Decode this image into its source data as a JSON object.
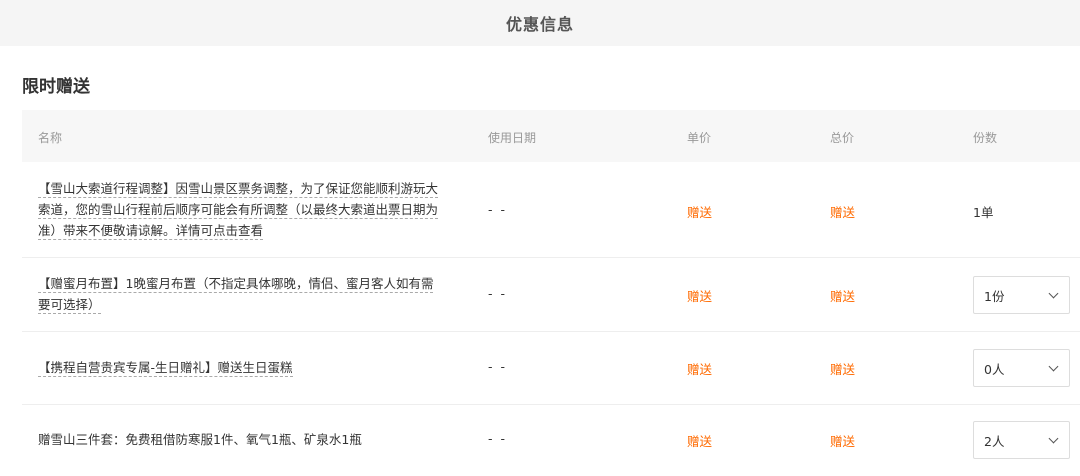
{
  "header": {
    "title": "优惠信息"
  },
  "section": {
    "title": "限时赠送"
  },
  "table": {
    "columns": [
      "名称",
      "使用日期",
      "单价",
      "总价",
      "份数"
    ],
    "rows": [
      {
        "name": "【雪山大索道行程调整】因雪山景区票务调整，为了保证您能顺利游玩大索道，您的雪山行程前后顺序可能会有所调整（以最终大索道出票日期为准）带来不便敬请谅解。详情可点击查看",
        "name_lines": [
          "【雪山大索道行程调整】因雪山景区票务调整，为了保证您能顺利游玩大",
          "索道，您的雪山行程前后顺序可能会有所调整（以最终大索道出票日期为",
          "准）带来不便敬请谅解。详情可点击查看"
        ],
        "date": "- -",
        "price": "赠送",
        "total": "赠送",
        "qty": "1单"
      },
      {
        "name_lines": [
          "【赠蜜月布置】1晚蜜月布置（不指定具体哪晚，情侣、蜜月客人如有需",
          "要可选择）"
        ],
        "date": "- -",
        "price": "赠送",
        "total": "赠送",
        "qty": "1份"
      },
      {
        "name_lines": [
          "【携程自营贵宾专属-生日赠礼】赠送生日蛋糕"
        ],
        "date": "- -",
        "price": "赠送",
        "total": "赠送",
        "qty": "0人"
      },
      {
        "name_lines": [
          "赠雪山三件套：免费租借防寒服1件、氧气1瓶、矿泉水1瓶"
        ],
        "date": "- -",
        "price": "赠送",
        "total": "赠送",
        "qty": "2人"
      }
    ]
  },
  "colors": {
    "accent": "#ff6a00",
    "header_bg": "#f5f5f5",
    "thead_bg": "#f7f7f7"
  },
  "icons": {
    "select_arrow": "chevron-down-icon"
  }
}
